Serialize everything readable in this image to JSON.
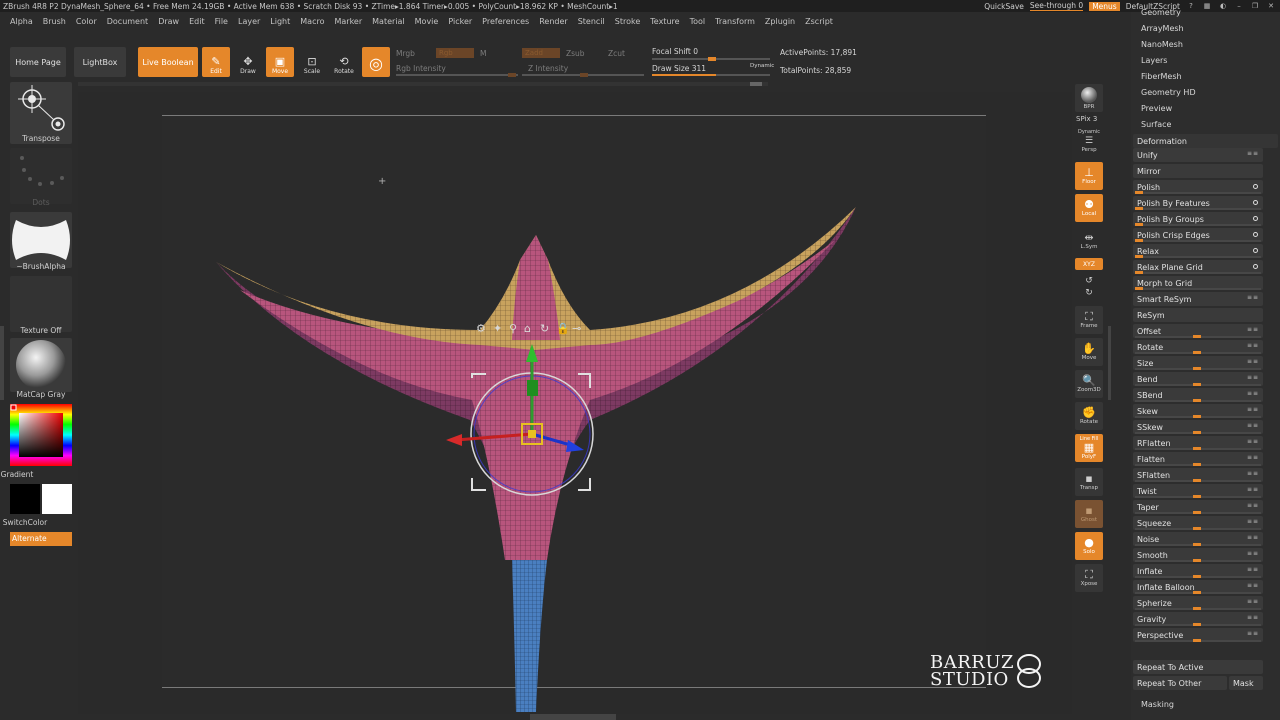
{
  "titlebar": {
    "text": "ZBrush 4R8 P2    DynaMesh_Sphere_64    • Free Mem 24.19GB • Active Mem 638 • Scratch Disk 93 • ZTime▸1.864 Timer▸0.005 • PolyCount▸18.962 KP • MeshCount▸1",
    "quicksave": "QuickSave",
    "see_through": "See-through  0",
    "menus": "Menus",
    "script": "DefaultZScript"
  },
  "menubar": [
    "Alpha",
    "Brush",
    "Color",
    "Document",
    "Draw",
    "Edit",
    "File",
    "Layer",
    "Light",
    "Macro",
    "Marker",
    "Material",
    "Movie",
    "Picker",
    "Preferences",
    "Render",
    "Stencil",
    "Stroke",
    "Texture",
    "Tool",
    "Transform",
    "Zplugin",
    "Zscript"
  ],
  "shelf": {
    "home": "Home Page",
    "lightbox": "LightBox",
    "live_boolean": "Live Boolean",
    "edit": "Edit",
    "draw": "Draw",
    "move": "Move",
    "scale": "Scale",
    "rotate": "Rotate",
    "mrgb": "Mrgb",
    "rgb": "Rgb",
    "m": "M",
    "rgb_intensity": "Rgb Intensity",
    "zadd": "Zadd",
    "zsub": "Zsub",
    "zcut": "Zcut",
    "z_intensity": "Z Intensity",
    "focal_shift": "Focal Shift 0",
    "draw_size": "Draw Size 311",
    "dynamic": "Dynamic",
    "active_points": "ActivePoints: 17,891",
    "total_points": "TotalPoints: 28,859"
  },
  "left": {
    "transpose": "Transpose",
    "dots": "Dots",
    "brush_alpha": "~BrushAlpha",
    "texture_off": "Texture Off",
    "matcap": "MatCap Gray",
    "gradient": "Gradient",
    "switch_color": "SwitchColor",
    "alternate": "Alternate"
  },
  "rstrip": {
    "bpr": "BPR",
    "spix": "SPix 3",
    "dynamic": "Dynamic",
    "persp": "Persp",
    "floor": "Floor",
    "local": "Local",
    "lsym": "L.Sym",
    "xyz": "XYZ",
    "frame": "Frame",
    "move": "Move",
    "zoom3d": "Zoom3D",
    "rotate": "Rotate",
    "linefill": "Line Fill",
    "polyf": "PolyF",
    "transp": "Transp",
    "ghost": "Ghost",
    "solo": "Solo",
    "xpose": "Xpose"
  },
  "rpanel": {
    "top_items": [
      "Geometry",
      "ArrayMesh",
      "NanoMesh",
      "Layers",
      "FiberMesh",
      "Geometry HD",
      "Preview",
      "Surface"
    ],
    "deformation": "Deformation",
    "deform_items": [
      "Unify",
      "Mirror",
      "Polish",
      "Polish By Features",
      "Polish By Groups",
      "Polish Crisp Edges",
      "Relax",
      "Relax Plane Grid",
      "Morph to Grid",
      "Smart ReSym",
      "ReSym",
      "Offset",
      "Rotate",
      "Size",
      "Bend",
      "SBend",
      "Skew",
      "SSkew",
      "RFlatten",
      "Flatten",
      "SFlatten",
      "Twist",
      "Taper",
      "Squeeze",
      "Noise",
      "Smooth",
      "Inflate",
      "Inflate Balloon",
      "Spherize",
      "Gravity",
      "Perspective"
    ],
    "repeat_active": "Repeat To Active",
    "repeat_other": "Repeat To Other",
    "mask": "Mask",
    "masking": "Masking"
  },
  "logo": {
    "line1": "BARRUZ",
    "line2": "STUDIO"
  },
  "colors": {
    "accent": "#e5872a",
    "bg": "#2b2b2b",
    "mesh_top": "#c8a25e",
    "mesh_body": "#b8557d",
    "mesh_stem": "#3f78b8"
  }
}
